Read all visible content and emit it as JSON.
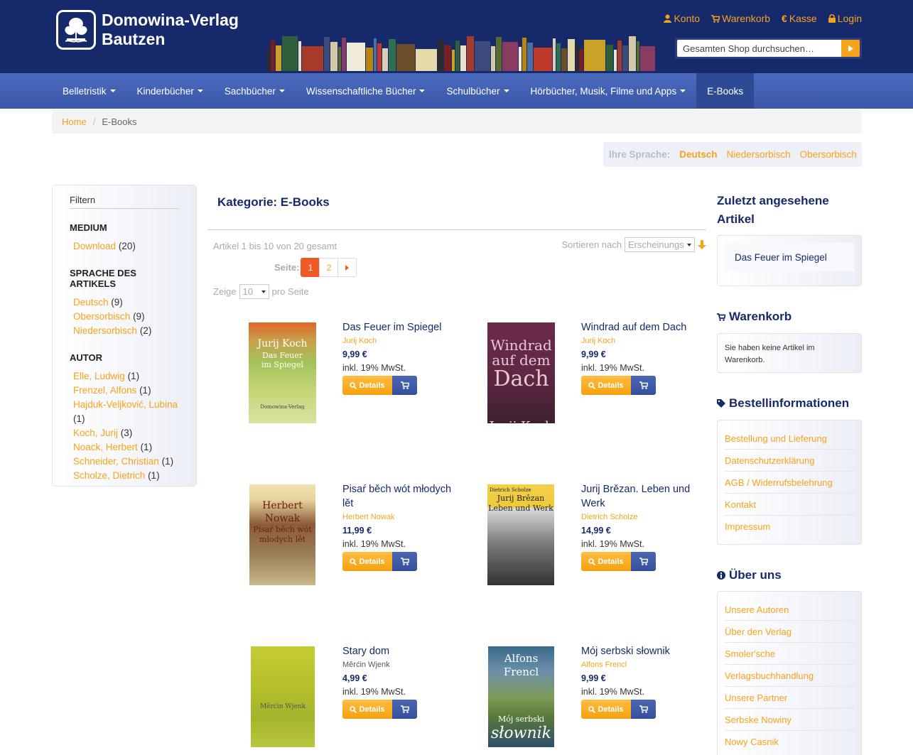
{
  "header": {
    "brand_line1": "Domowina-Verlag",
    "brand_line2": "Bautzen",
    "top_links": [
      {
        "label": "Konto",
        "icon": "user-icon"
      },
      {
        "label": "Warenkorb",
        "icon": "cart-icon"
      },
      {
        "label": "Kasse",
        "icon": "euro-icon"
      },
      {
        "label": "Login",
        "icon": "lock-icon"
      }
    ],
    "search_placeholder": "Gesamten Shop durchsuchen…"
  },
  "nav": {
    "items": [
      {
        "label": "Belletristik",
        "dropdown": true
      },
      {
        "label": "Kinderbücher",
        "dropdown": true
      },
      {
        "label": "Sachbücher",
        "dropdown": true
      },
      {
        "label": "Wissenschaftliche Bücher",
        "dropdown": true
      },
      {
        "label": "Schulbücher",
        "dropdown": true
      },
      {
        "label": "Hörbücher, Musik, Filme und Apps",
        "dropdown": true
      },
      {
        "label": "E-Books",
        "dropdown": false,
        "active": true
      }
    ]
  },
  "breadcrumb": {
    "home": "Home",
    "separator": "/",
    "current": "E-Books"
  },
  "language": {
    "label": "Ihre Sprache:",
    "options": [
      "Deutsch",
      "Niedersorbisch",
      "Obersorbisch"
    ],
    "active": "Deutsch"
  },
  "filter": {
    "title": "Filtern",
    "groups": [
      {
        "heading": "MEDIUM",
        "items": [
          {
            "label": "Download",
            "count": "(20)"
          }
        ]
      },
      {
        "heading": "SPRACHE DES ARTIKELS",
        "items": [
          {
            "label": "Deutsch",
            "count": "(9)"
          },
          {
            "label": "Obersorbisch",
            "count": "(9)"
          },
          {
            "label": "Niedersorbisch",
            "count": "(2)"
          }
        ]
      },
      {
        "heading": "AUTOR",
        "items": [
          {
            "label": "Elle, Ludwig",
            "count": "(1)"
          },
          {
            "label": "Frenzel, Alfons",
            "count": "(1)"
          },
          {
            "label": "Hajduk-Veljković, Lubina",
            "count": "(1)"
          },
          {
            "label": "Koch, Jurij",
            "count": "(3)"
          },
          {
            "label": "Noack, Herbert",
            "count": "(1)"
          },
          {
            "label": "Schneider, Christian",
            "count": "(1)"
          },
          {
            "label": "Scholze, Dietrich",
            "count": "(1)"
          }
        ]
      }
    ]
  },
  "main": {
    "category_title": "Kategorie: E-Books",
    "result_count": "Artikel 1 bis 10 von 20 gesamt",
    "sort_label": "Sortieren nach",
    "sort_value": "Erscheinungs",
    "pager_label": "Seite:",
    "pages": [
      "1",
      "2"
    ],
    "current_page": "1",
    "show_label": "Zeige",
    "per_page": "10",
    "per_page_suffix": "pro Seite",
    "details_label": "Details",
    "products": [
      {
        "title": "Das Feuer im Spiegel",
        "author": "Jurij Koch",
        "price": "9,99 €",
        "tax": "inkl. 19% MwSt.",
        "cover_text": [
          "Jurij Koch",
          "Das Feuer",
          "im Spiegel",
          "Domowina-Verlag"
        ]
      },
      {
        "title": "Windrad auf dem Dach",
        "author": "Jurij Koch",
        "price": "9,99 €",
        "tax": "inkl. 19% MwSt.",
        "cover_text": [
          "Windrad",
          "auf dem",
          "Dach",
          "Jurij Koch"
        ]
      },
      {
        "title": "Pisaŕ běch wót młodych lět",
        "author": "Herbert Nowak",
        "price": "11,99 €",
        "tax": "inkl. 19% MwSt.",
        "cover_text": [
          "Herbert Nowak",
          "Pisaŕ běch wót młodych lět"
        ]
      },
      {
        "title": "Jurij Brězan. Leben und Werk",
        "author": "Dietrich Scholze",
        "price": "14,99 €",
        "tax": "inkl. 19% MwSt.",
        "cover_text": [
          "Dietrich Scholze",
          "Jurij Brězan",
          "Leben und Werk"
        ]
      },
      {
        "title": "Stary dom",
        "author": "Měrćin Wjenk",
        "price": "4,99 €",
        "tax": "inkl. 19% MwSt.",
        "cover_text": [
          "Měrćin Wjenk"
        ]
      },
      {
        "title": "Mój serbski słownik",
        "author": "Alfons Frencl",
        "price": "9,99 €",
        "tax": "inkl. 19% MwSt.",
        "cover_text": [
          "Alfons Frencl",
          "Mój serbski",
          "słownik"
        ]
      }
    ]
  },
  "right": {
    "recent_heading": "Zuletzt angesehene Artikel",
    "recent_item": "Das Feuer im Spiegel",
    "cart_heading": "Warenkorb",
    "cart_text": "Sie haben keine Artikel im Warenkorb.",
    "order_heading": "Bestellinformationen",
    "order_links": [
      "Bestellung und Lieferung",
      "Datenschutzerklärung",
      "AGB / Widerrufsbelehrung",
      "Kontakt",
      "Impressum"
    ],
    "about_heading": "Über uns",
    "about_links": [
      "Unsere Autoren",
      "Über den Verlag",
      "Smoler'sche",
      "Verlagsbuchhandlung",
      "Unsere Partner",
      "Serbske Nowiny",
      "Nowy Casnik"
    ]
  },
  "colors": {
    "navy": "#16296b",
    "accent": "#f7a21b",
    "nav_blue": "#4b6bbf"
  }
}
